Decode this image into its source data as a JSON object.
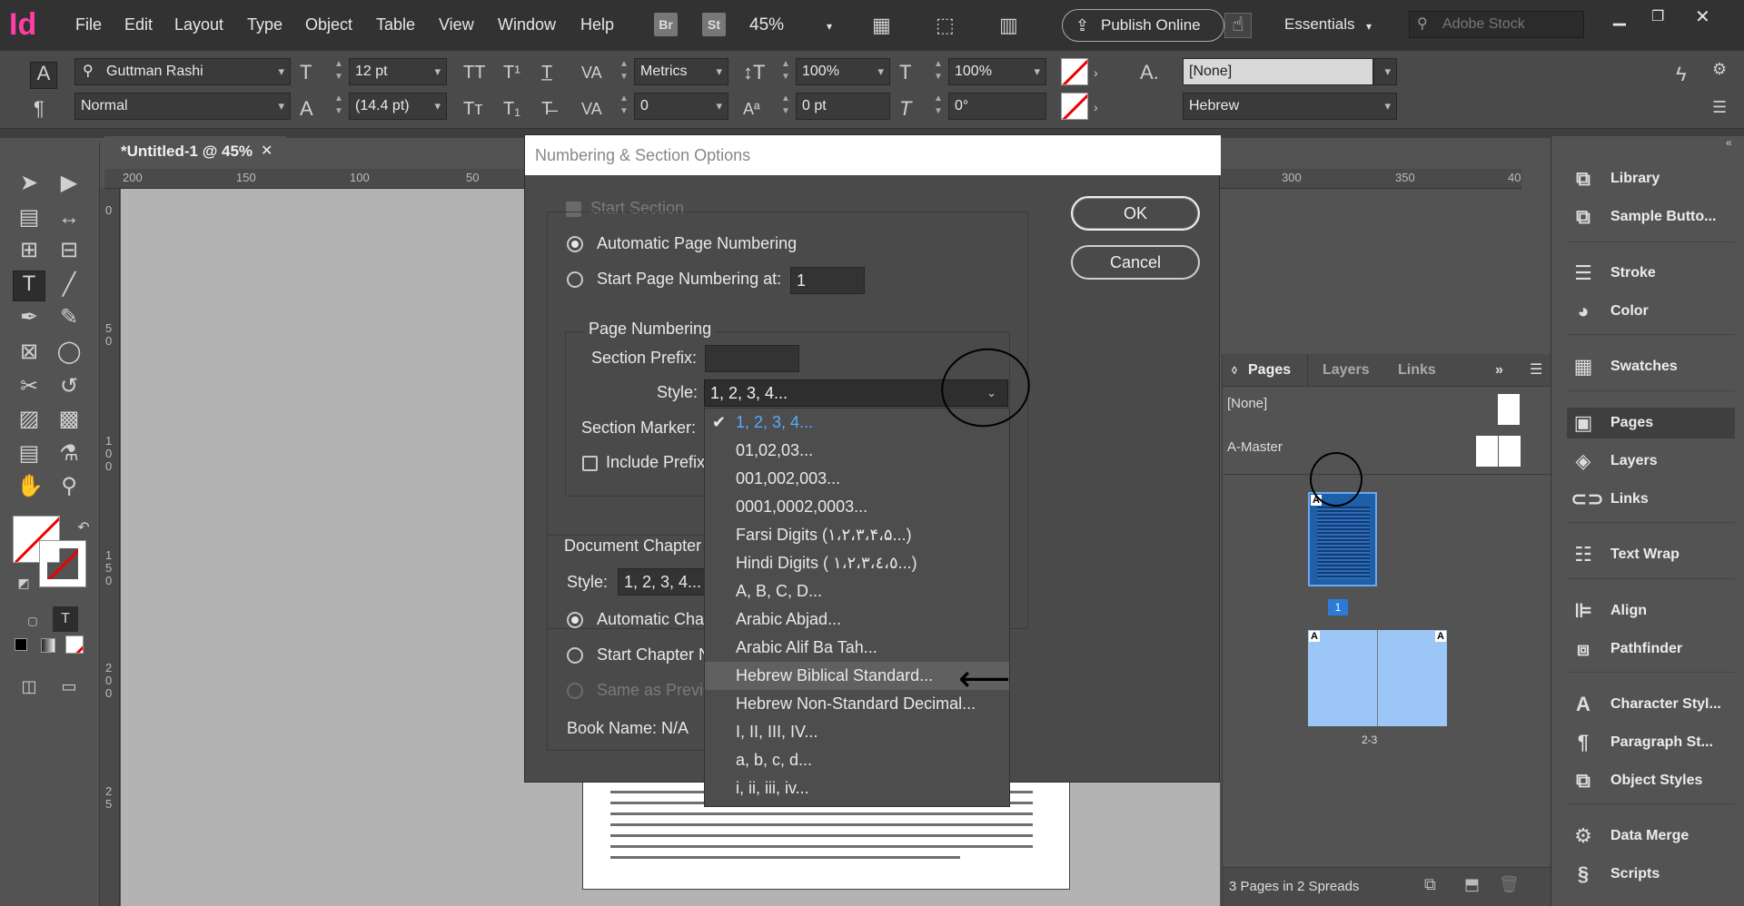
{
  "app": {
    "logo": "Id",
    "menu": [
      "File",
      "Edit",
      "Layout",
      "Type",
      "Object",
      "Table",
      "View",
      "Window",
      "Help"
    ],
    "bridge_btn": "Br",
    "stock_btn": "St",
    "zoom": "45%",
    "publish": "Publish Online",
    "workspace": "Essentials",
    "search_placeholder": "Adobe Stock"
  },
  "control": {
    "font": "Guttman Rashi",
    "font_style": "Normal",
    "size": "12 pt",
    "leading": "(14.4 pt)",
    "kerning": "Metrics",
    "tracking": "0",
    "vscale": "100%",
    "hscale": "100%",
    "baseline": "0 pt",
    "skew": "0°",
    "char_style": "[None]",
    "language": "Hebrew"
  },
  "document": {
    "tab_title": "*Untitled-1 @ 45%",
    "ruler_h": [
      "200",
      "150",
      "100",
      "50",
      "300",
      "350",
      "40"
    ],
    "ruler_v": [
      "0",
      "5",
      "0",
      "1",
      "0",
      "0",
      "1",
      "5",
      "0",
      "2",
      "0",
      "0",
      "2",
      "5"
    ]
  },
  "dialog": {
    "title": "Numbering & Section Options",
    "start_section": "Start Section",
    "auto_numbering": "Automatic Page Numbering",
    "start_numbering_at": "Start Page Numbering at:",
    "start_value": "1",
    "page_numbering_group": "Page Numbering",
    "section_prefix": "Section Prefix:",
    "style_label": "Style:",
    "style_value": "1, 2, 3, 4...",
    "section_marker": "Section Marker:",
    "include_prefix": "Include Prefix",
    "doc_chapter_group": "Document Chapter",
    "chapter_style_label": "Style:",
    "chapter_style_value": "1, 2, 3, 4...",
    "auto_chapter": "Automatic Chap",
    "start_chapter": "Start Chapter N",
    "same_as_previous": "Same as Previc",
    "book_name": "Book Name: N/A",
    "ok": "OK",
    "cancel": "Cancel",
    "style_options": [
      "1, 2, 3, 4...",
      "01,02,03...",
      "001,002,003...",
      "0001,0002,0003...",
      "Farsi Digits (١،٢،٣،۴،۵...)",
      "Hindi Digits ( ١،٢،٣،٤،٥...)",
      "A, B, C, D...",
      "Arabic Abjad...",
      "Arabic Alif Ba Tah...",
      "Hebrew Biblical Standard...",
      "Hebrew Non-Standard Decimal...",
      "I, II, III, IV...",
      "a, b, c, d...",
      "i, ii, iii, iv..."
    ],
    "selected_index": 0,
    "highlight_index": 9,
    "arrow_glyph": "⟵"
  },
  "pages_panel": {
    "tabs": [
      "Pages",
      "Layers",
      "Links"
    ],
    "none_master": "[None]",
    "a_master": "A-Master",
    "page1_label": "1",
    "page_marker": "A",
    "spread2_label": "2-3",
    "footer": "3 Pages in 2 Spreads"
  },
  "dock": {
    "items": [
      "Library",
      "Sample Butto...",
      "Stroke",
      "Color",
      "Swatches",
      "Pages",
      "Layers",
      "Links",
      "Text Wrap",
      "Align",
      "Pathfinder",
      "Character Styl...",
      "Paragraph St...",
      "Object Styles",
      "Data Merge",
      "Scripts"
    ]
  }
}
